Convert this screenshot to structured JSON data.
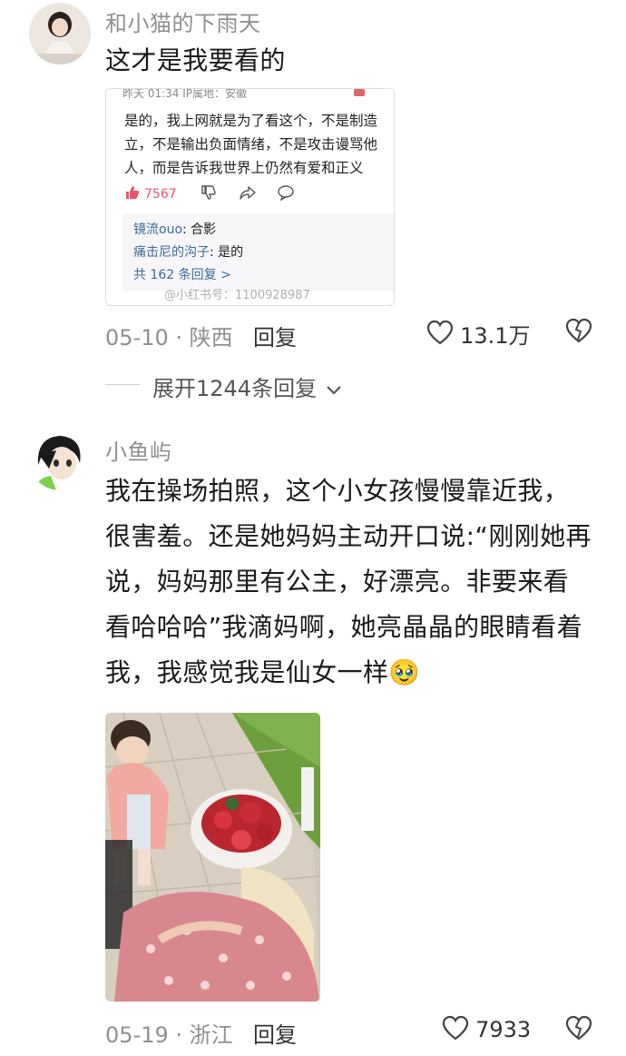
{
  "comment1": {
    "username": "和小猫的下雨天",
    "text": "这才是我要看的",
    "embed": {
      "meta": "昨天 01:34 IP属地：安徽",
      "lines": [
        "是的，我上网就是为了看这个，不是制造",
        "立，不是输出负面情绪，不是攻击谩骂他",
        "人，而是告诉我世界上仍然有爱和正义"
      ],
      "likes": "7567",
      "replies": [
        {
          "name": "镜流ouo",
          "text": ": 合影"
        },
        {
          "name": "痛击尼的沟子",
          "text": ": 是的"
        }
      ],
      "more": "共 162 条回复 >",
      "watermark": "@小红书号：1100928987"
    },
    "date_location": "05-10 · 陕西",
    "reply_label": "回复",
    "likes": "13.1万",
    "expand_label": "展开1244条回复"
  },
  "comment2": {
    "username": "小鱼屿",
    "lines": [
      "我在操场拍照，这个小女孩慢慢靠近我，",
      "很害羞。还是她妈妈主动开口说:“刚刚她再",
      "说，妈妈那里有公主，好漂亮。非要来看",
      "看哈哈哈”我滴妈啊，她亮晶晶的眼睛看着",
      "我，我感觉我是仙女一样"
    ],
    "emoji": "🥹",
    "date_location": "05-19 · 浙江",
    "reply_label": "回复",
    "likes": "7933"
  },
  "icons": {
    "heart": "heart-icon",
    "dislike": "broken-heart-icon",
    "chevron": "chevron-down-icon",
    "thumbs_up": "thumbs-up-icon"
  },
  "colors": {
    "muted_text": "#8f8f8f",
    "link_blue": "#3c6a9c",
    "like_red": "#e8546b"
  }
}
